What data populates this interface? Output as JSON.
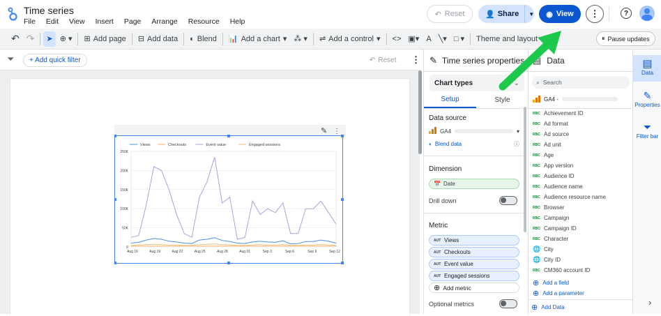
{
  "header": {
    "title": "Time series",
    "menu": [
      "File",
      "Edit",
      "View",
      "Insert",
      "Page",
      "Arrange",
      "Resource",
      "Help"
    ],
    "reset_label": "Reset",
    "share_label": "Share",
    "view_label": "View"
  },
  "toolbar": {
    "add_page": "Add page",
    "add_data": "Add data",
    "blend": "Blend",
    "add_chart": "Add a chart",
    "add_control": "Add a control",
    "theme": "Theme and layout",
    "pause": "Pause updates"
  },
  "filterbar": {
    "add_filter": "+ Add quick filter",
    "reset": "Reset"
  },
  "props": {
    "title": "Time series properties",
    "chart_types": "Chart types",
    "tabs": [
      "Setup",
      "Style"
    ],
    "data_source_label": "Data source",
    "data_source": "GA4",
    "blend": "Blend data",
    "dimension_label": "Dimension",
    "dimension": "Date",
    "drill_down": "Drill down",
    "metric_label": "Metric",
    "metric_tag": "AUT",
    "metrics": [
      "Views",
      "Checkouts",
      "Event value",
      "Engaged sessions"
    ],
    "add_metric": "Add metric",
    "optional_metrics": "Optional metrics"
  },
  "data": {
    "title": "Data",
    "search_placeholder": "Search",
    "source": "GA4 -",
    "field_tag": "RBC",
    "fields": [
      "Achievement ID",
      "Ad format",
      "Ad source",
      "Ad unit",
      "Age",
      "App version",
      "Audience ID",
      "Audience name",
      "Audience resource name",
      "Browser",
      "Campaign",
      "Campaign ID",
      "Character",
      "City",
      "City ID",
      "CM360 account ID"
    ],
    "add_field": "Add a field",
    "add_parameter": "Add a parameter",
    "add_data": "Add Data"
  },
  "rail": {
    "items": [
      "Data",
      "Properties",
      "Filter bar"
    ]
  },
  "chart_data": {
    "type": "line",
    "legend": [
      "Views",
      "Checkouts",
      "Event value",
      "Engaged sessions"
    ],
    "colors": [
      "#4a90e2",
      "#f6b26b",
      "#b39ddb",
      "#e6c27a"
    ],
    "x_ticks": [
      "Aug 16",
      "Aug 19",
      "Aug 22",
      "Aug 25",
      "Aug 28",
      "Aug 31",
      "Sep 3",
      "Sep 6",
      "Sep 9",
      "Sep 12"
    ],
    "y_ticks": [
      "0",
      "50K",
      "100K",
      "150K",
      "200K",
      "250K"
    ],
    "ylim": [
      0,
      250000
    ],
    "series": [
      {
        "name": "Event value",
        "values": [
          25000,
          30000,
          110000,
          210000,
          200000,
          150000,
          85000,
          35000,
          25000,
          130000,
          170000,
          235000,
          115000,
          130000,
          20000,
          25000,
          120000,
          85000,
          100000,
          90000,
          115000,
          35000,
          35000,
          100000,
          100000,
          120000,
          90000,
          60000
        ]
      },
      {
        "name": "Views",
        "values": [
          10000,
          12000,
          18000,
          22000,
          20000,
          15000,
          13000,
          10000,
          9000,
          18000,
          20000,
          24000,
          17000,
          14000,
          10000,
          9000,
          13000,
          15000,
          13000,
          12000,
          16000,
          8000,
          9000,
          14000,
          14000,
          18000,
          15000,
          10000
        ]
      },
      {
        "name": "Checkouts",
        "values": [
          2000,
          2000,
          2000,
          2000,
          2000,
          2000,
          2000,
          2000,
          2000,
          2000,
          2000,
          2000,
          2000,
          2000,
          2000,
          2000,
          2000,
          2000,
          2000,
          2000,
          2000,
          2000,
          2000,
          2000,
          2000,
          2000,
          2000,
          2000
        ]
      },
      {
        "name": "Engaged sessions",
        "values": [
          4000,
          5000,
          6000,
          7000,
          6000,
          5000,
          5000,
          4000,
          4000,
          6000,
          7000,
          8000,
          6000,
          5000,
          4000,
          4000,
          5000,
          6000,
          5000,
          5000,
          6000,
          4000,
          4000,
          5000,
          5000,
          6000,
          5000,
          4000
        ]
      }
    ]
  }
}
